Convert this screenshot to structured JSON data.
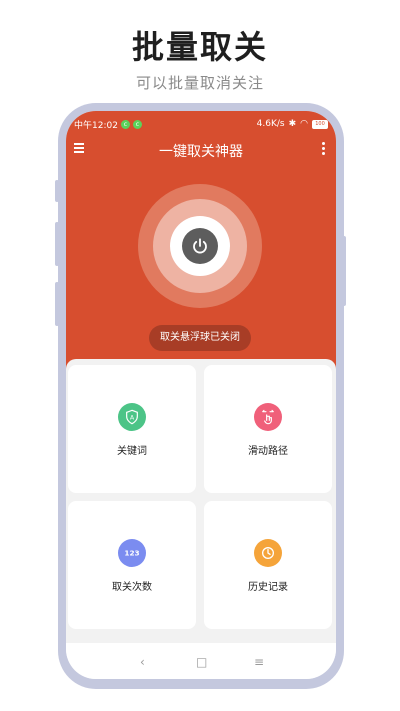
{
  "promo": {
    "title": "批量取关",
    "subtitle": "可以批量取消关注"
  },
  "status_bar": {
    "time": "中午12:02",
    "speed": "4.6K/s",
    "battery": "100"
  },
  "app_bar": {
    "title": "一键取关神器"
  },
  "hero": {
    "status_text": "取关悬浮球已关闭"
  },
  "features": [
    {
      "label": "关键词",
      "icon": "shield-a-icon",
      "color": "#4cc487"
    },
    {
      "label": "滑动路径",
      "icon": "swipe-hand-icon",
      "color": "#f0607a"
    },
    {
      "label": "取关次数",
      "icon": "numbers-123-icon",
      "color": "#7b8cf0"
    },
    {
      "label": "历史记录",
      "icon": "clock-icon",
      "color": "#f5a43a"
    }
  ],
  "colors": {
    "brand_red": "#d74e2f",
    "pill": "#a83d26",
    "frame": "#c4c8de"
  }
}
